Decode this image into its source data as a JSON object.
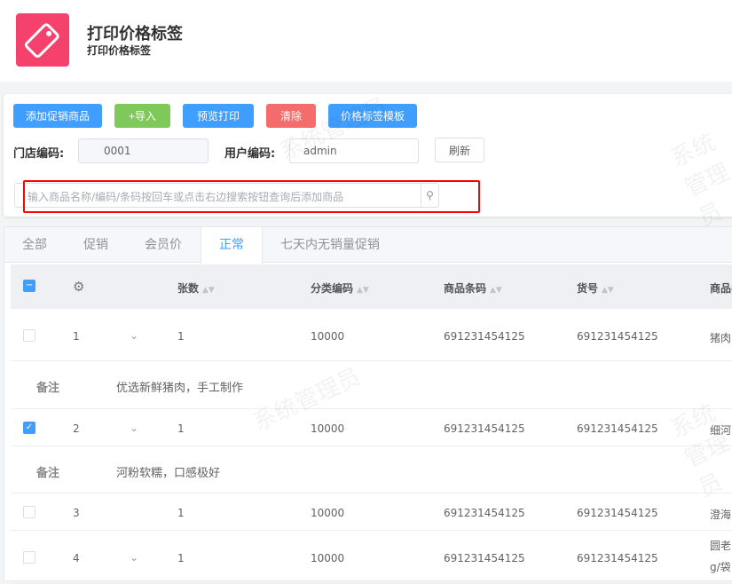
{
  "header": {
    "title": "打印价格标签",
    "subtitle": "打印价格标签"
  },
  "toolbar": {
    "add_promo": "添加促销商品",
    "import": "+导入",
    "preview": "预览打印",
    "clear": "清除",
    "template": "价格标签模板"
  },
  "form": {
    "store_label": "门店编码:",
    "store_value": "0001",
    "user_label": "用户编码:",
    "user_value": "admin",
    "refresh": "刷新",
    "search_placeholder": "输入商品名称/编码/条码按回车或点击右边搜索按钮查询后添加商品"
  },
  "tabs": [
    "全部",
    "促销",
    "会员价",
    "正常",
    "七天内无销量促销"
  ],
  "columns": [
    "张数",
    "分类编码",
    "商品条码",
    "货号",
    "商品名"
  ],
  "remark_label": "备注",
  "rows": [
    {
      "idx": "1",
      "qty": "1",
      "cat": "10000",
      "barcode": "691231454125",
      "sku": "691231454125",
      "name": "猪肉",
      "checked": false,
      "remark": "优选新鲜猪肉，手工制作"
    },
    {
      "idx": "2",
      "qty": "1",
      "cat": "10000",
      "barcode": "691231454125",
      "sku": "691231454125",
      "name": "细河",
      "checked": true,
      "remark": "河粉软糯，口感极好"
    },
    {
      "idx": "3",
      "qty": "1",
      "cat": "10000",
      "barcode": "691231454125",
      "sku": "691231454125",
      "name": "澄海",
      "checked": false
    },
    {
      "idx": "4",
      "qty": "1",
      "cat": "10000",
      "barcode": "691231454125",
      "sku": "691231454125",
      "name": "圆老",
      "name2": "g/袋",
      "checked": false
    }
  ],
  "watermark": "系统管理员",
  "colors": {
    "primary": "#409eff",
    "success": "#7ec95a",
    "danger": "#f56c6c",
    "logo": "#f5426c"
  }
}
